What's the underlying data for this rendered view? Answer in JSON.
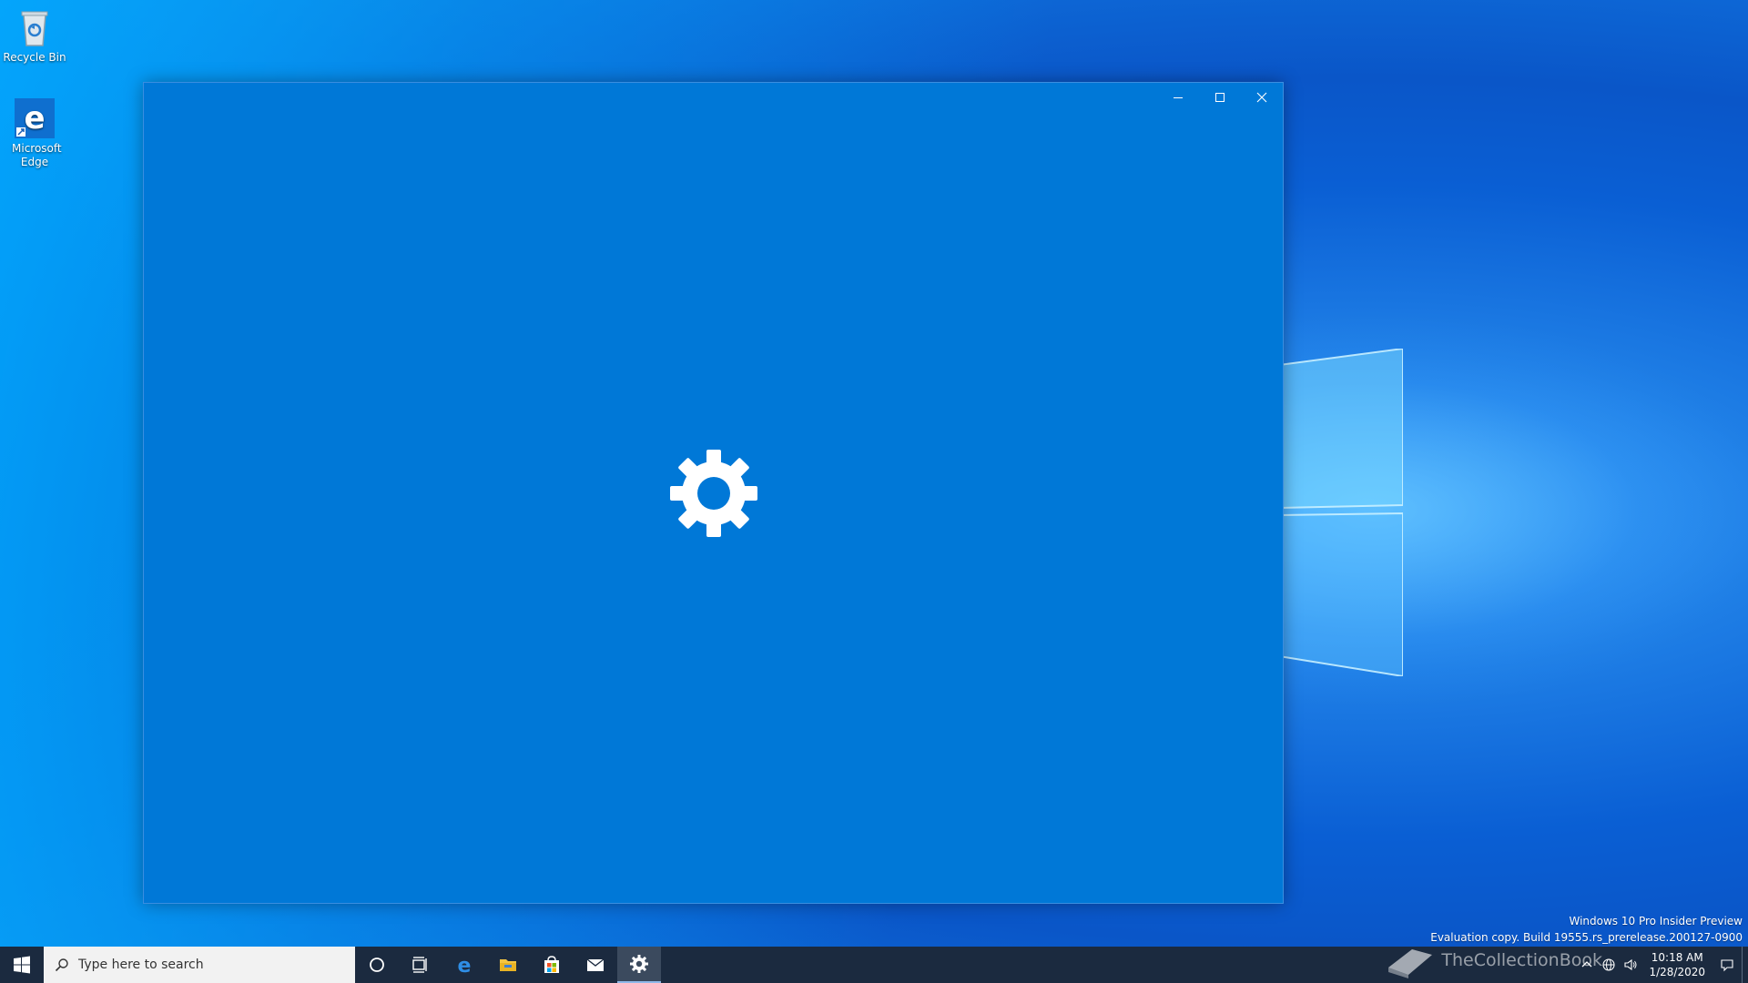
{
  "desktop": {
    "icons": [
      {
        "label": "Recycle Bin"
      },
      {
        "label": "Microsoft Edge"
      }
    ]
  },
  "window": {
    "controls": {
      "minimize": "minimize-icon",
      "maximize": "maximize-icon",
      "close": "close-icon"
    },
    "splash_icon": "gear-icon",
    "background": "#0078d7"
  },
  "watermark": {
    "line1": "Windows 10 Pro Insider Preview",
    "line2": "Evaluation copy. Build 19555.rs_prerelease.200127-0900"
  },
  "taskbar": {
    "search_placeholder": "Type here to search",
    "pinned": [
      "cortana-icon",
      "task-view-icon",
      "edge-icon",
      "file-explorer-icon",
      "store-icon",
      "mail-icon",
      "settings-icon"
    ],
    "active_app": "settings",
    "tray": {
      "brand_text": "TheCollectionBook",
      "time": "10:18 AM",
      "date": "1/28/2020"
    }
  },
  "colors": {
    "taskbar": "#1b2a3f",
    "accent": "#0078d7"
  }
}
